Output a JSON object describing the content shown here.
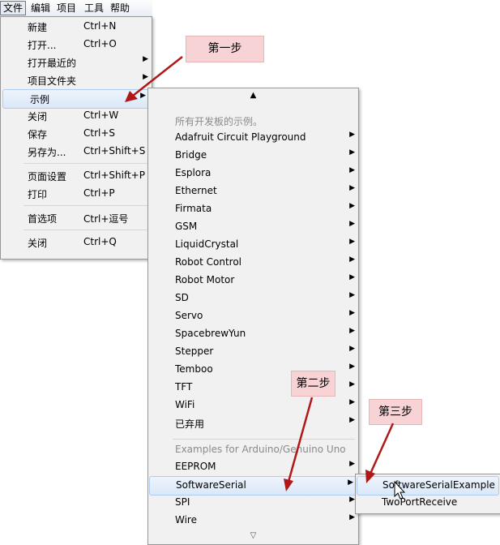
{
  "menubar": [
    "文件",
    "编辑",
    "项目",
    "工具",
    "帮助"
  ],
  "file_menu": {
    "groups": [
      [
        {
          "label": "新建",
          "shortcut": "Ctrl+N"
        },
        {
          "label": "打开...",
          "shortcut": "Ctrl+O"
        },
        {
          "label": "打开最近的",
          "shortcut": "",
          "submenu": true
        },
        {
          "label": "项目文件夹",
          "shortcut": "",
          "submenu": true
        },
        {
          "label": "示例",
          "shortcut": "",
          "submenu": true,
          "active": true
        },
        {
          "label": "关闭",
          "shortcut": "Ctrl+W"
        },
        {
          "label": "保存",
          "shortcut": "Ctrl+S"
        },
        {
          "label": "另存为...",
          "shortcut": "Ctrl+Shift+S"
        }
      ],
      [
        {
          "label": "页面设置",
          "shortcut": "Ctrl+Shift+P"
        },
        {
          "label": "打印",
          "shortcut": "Ctrl+P"
        }
      ],
      [
        {
          "label": "首选项",
          "shortcut": "Ctrl+逗号"
        }
      ],
      [
        {
          "label": "关闭",
          "shortcut": "Ctrl+Q"
        }
      ]
    ]
  },
  "examples_menu": {
    "scroll_up": "▲",
    "scroll_down": "▽",
    "section1_header": "所有开发板的示例。",
    "section1_items": [
      "Adafruit Circuit Playground",
      "Bridge",
      "Esplora",
      "Ethernet",
      "Firmata",
      "GSM",
      "LiquidCrystal",
      "Robot Control",
      "Robot Motor",
      "SD",
      "Servo",
      "SpacebrewYun",
      "Stepper",
      "Temboo",
      "TFT",
      "WiFi",
      "已弃用"
    ],
    "section2_header": "Examples for Arduino/Genuino Uno",
    "section2_items": [
      "EEPROM",
      "SoftwareSerial",
      "SPI",
      "Wire"
    ],
    "active_item": "SoftwareSerial"
  },
  "softwareserial_menu": {
    "items": [
      "SoftwareSerialExample",
      "TwoPortReceive"
    ],
    "active_item": "SoftwareSerialExample"
  },
  "annotations": [
    "第一步",
    "第二步",
    "第三步"
  ],
  "colors": {
    "annotation_bg": "#f8d3d6",
    "arrow": "#b01818",
    "highlight": "#dbe8f8"
  }
}
